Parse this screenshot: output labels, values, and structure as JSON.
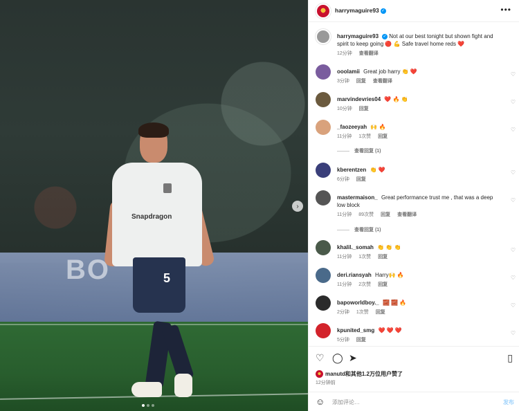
{
  "header": {
    "username": "harrymaguire93",
    "more_icon": "more-horizontal-icon"
  },
  "caption": {
    "username": "harrymaguire93",
    "text": "Not at our best tonight but shown fight and spirit to keep going 🔴 💪 Safe travel home reds ❤️",
    "time": "12分钟",
    "translate": "查看翻译"
  },
  "comments": [
    {
      "username": "ooolamii",
      "text": "Great job harry 👏 ❤️",
      "time": "3分钟",
      "reply": "回复",
      "translate": "查看翻译",
      "avatar_color": "#7a5c9e"
    },
    {
      "username": "marvindevries04",
      "text": "❤️ 🔥 👏",
      "time": "10分钟",
      "reply": "回复",
      "avatar_color": "#6b5a3e"
    },
    {
      "username": "_faozeeyah",
      "text": "🙌 🔥",
      "time": "11分钟",
      "likes": "1次赞",
      "reply": "回复",
      "avatar_color": "#d9a27c",
      "view_replies": "查看回复 (1)"
    },
    {
      "username": "kberentzen",
      "text": "👏 ❤️",
      "time": "6分钟",
      "reply": "回复",
      "avatar_color": "#3a3f7a"
    },
    {
      "username": "mastermaison_",
      "text": "Great performance trust me , that was a deep low block",
      "time": "11分钟",
      "likes": "89次赞",
      "reply": "回复",
      "translate": "查看翻译",
      "avatar_color": "#555555",
      "view_replies": "查看回复 (1)"
    },
    {
      "username": "khalil._somah",
      "text": "👏 👏 👏",
      "time": "11分钟",
      "likes": "1次赞",
      "reply": "回复",
      "avatar_color": "#4a5a4a"
    },
    {
      "username": "deri.riansyah",
      "text": "Harry🙌 🔥",
      "time": "11分钟",
      "likes": "2次赞",
      "reply": "回复",
      "avatar_color": "#4a6a8a"
    },
    {
      "username": "bapoworldboy._",
      "text": "🧱 🧱 🔥",
      "time": "2分钟",
      "likes": "1次赞",
      "reply": "回复",
      "avatar_color": "#2b2b2b"
    },
    {
      "username": "kpunited_smg",
      "text": "❤️ ❤️ ❤️",
      "time": "5分钟",
      "reply": "回复",
      "avatar_color": "#d3232b"
    }
  ],
  "actions": {
    "like": "heart-icon",
    "comment": "comment-icon",
    "share": "share-icon",
    "save": "bookmark-icon"
  },
  "likes_text": "manutd和其他1.2万位用户赞了",
  "post_time": "12分钟前",
  "compose": {
    "placeholder": "添加评论…",
    "post_label": "发布"
  },
  "photo": {
    "board_text": "BO",
    "sponsor_text": "Snapdragon",
    "shirt_number": "5"
  }
}
